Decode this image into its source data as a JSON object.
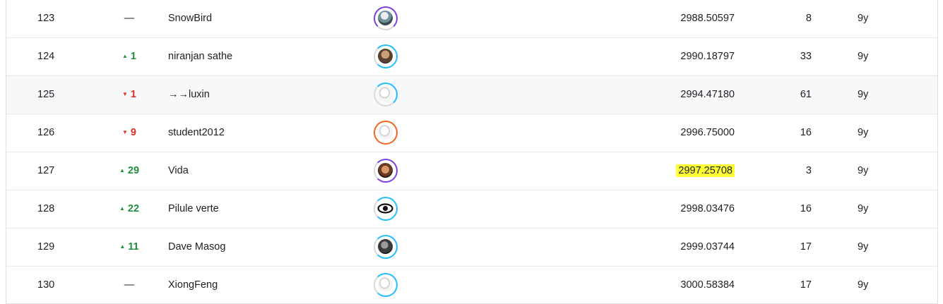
{
  "colors": {
    "up": "#1e8e3e",
    "down": "#d93025",
    "highlight": "#ffff33",
    "ring_purple": "#7b3fe4",
    "ring_blue": "#20beff",
    "ring_orange": "#f26522"
  },
  "rows": [
    {
      "rank": "123",
      "change": "—",
      "change_dir": "none",
      "name": "SnowBird",
      "avatar": "photo-avatar",
      "ring": "purple",
      "score": "2988.50597",
      "entries": "8",
      "last": "9y"
    },
    {
      "rank": "124",
      "change": "1",
      "change_dir": "up",
      "name": "niranjan sathe",
      "avatar": "photo-avatar",
      "ring": "blue",
      "score": "2990.18797",
      "entries": "33",
      "last": "9y"
    },
    {
      "rank": "125",
      "change": "1",
      "change_dir": "down",
      "name": "→→luxin",
      "avatar": "default-goose-avatar",
      "ring": "blue",
      "score": "2994.47180",
      "entries": "61",
      "last": "9y"
    },
    {
      "rank": "126",
      "change": "9",
      "change_dir": "down",
      "name": "student2012",
      "avatar": "default-goose-avatar",
      "ring": "orange",
      "score": "2996.75000",
      "entries": "16",
      "last": "9y"
    },
    {
      "rank": "127",
      "change": "29",
      "change_dir": "up",
      "name": "Vida",
      "avatar": "photo-avatar",
      "ring": "purple",
      "score": "2997.25708",
      "entries": "3",
      "last": "9y"
    },
    {
      "rank": "128",
      "change": "22",
      "change_dir": "up",
      "name": "Pilule verte",
      "avatar": "eye-avatar",
      "ring": "blue",
      "score": "2998.03476",
      "entries": "16",
      "last": "9y"
    },
    {
      "rank": "129",
      "change": "11",
      "change_dir": "up",
      "name": "Dave Masog",
      "avatar": "photo-avatar",
      "ring": "blue",
      "score": "2999.03744",
      "entries": "17",
      "last": "9y"
    },
    {
      "rank": "130",
      "change": "—",
      "change_dir": "none",
      "name": "XiongFeng",
      "avatar": "default-goose-avatar",
      "ring": "blue",
      "score": "3000.58384",
      "entries": "17",
      "last": "9y"
    }
  ],
  "highlighted_row": "127",
  "hovered_row": "125"
}
